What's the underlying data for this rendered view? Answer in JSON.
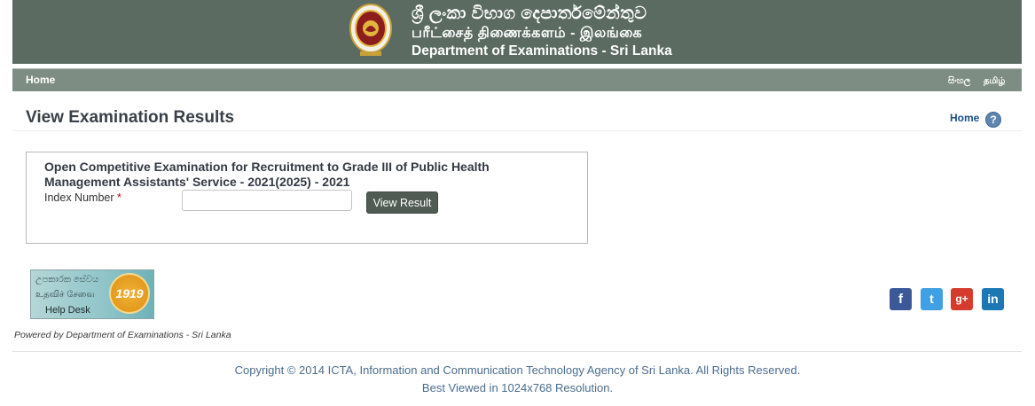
{
  "header": {
    "title_sinhala": "ශ්‍රී ලංකා විභාග දෙපාර්තමේන්තුව",
    "title_tamil": "பரீட்சைத் திணைக்களம் - இலங்கை",
    "title_english": "Department of Examinations - Sri Lanka",
    "emblem_icon": "sri-lanka-emblem-icon"
  },
  "nav": {
    "home": "Home",
    "lang_sinhala": "සිංහල",
    "lang_tamil": "தமிழ்"
  },
  "page": {
    "title": "View Examination Results",
    "home_link": "Home",
    "help_icon": "?"
  },
  "exam": {
    "title": "Open Competitive Examination for Recruitment to Grade III of Public Health Management Assistants' Service - 2021(2025) - 2021",
    "index_label": "Index Number",
    "required_mark": "*",
    "index_value": "",
    "button_label": "View Result"
  },
  "helpdesk": {
    "sinhala": "උපකාරක සේවය",
    "tamil": "உதவிச் சேவை",
    "english": "Help Desk",
    "number": "1919"
  },
  "social": {
    "facebook": "f",
    "twitter": "t",
    "googleplus": "g+",
    "linkedin": "in"
  },
  "footer": {
    "powered_by": "Powered by Department of Examinations - Sri Lanka",
    "copyright": "Copyright © 2014 ICTA, Information and Communication Technology Agency of Sri Lanka. All Rights Reserved.",
    "best_viewed": "Best Viewed in 1024x768 Resolution."
  },
  "colors": {
    "banner": "#5b6b61",
    "navbar": "#7e8d83",
    "button": "#4f5b53",
    "link": "#1a4f8b"
  }
}
